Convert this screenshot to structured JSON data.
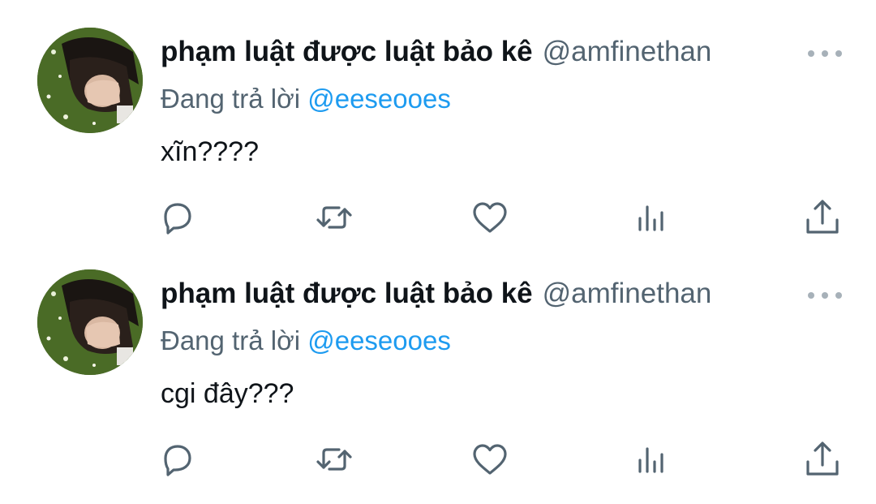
{
  "tweets": [
    {
      "author": {
        "name": "phạm luật được luật bảo kê",
        "handle": "@amfinethan"
      },
      "replying_prefix": "Đang trả lời",
      "replying_to": "@eeseooes",
      "text": "xĩn????"
    },
    {
      "author": {
        "name": "phạm luật được luật bảo kê",
        "handle": "@amfinethan"
      },
      "replying_prefix": "Đang trả lời",
      "replying_to": "@eeseooes",
      "text": "cgi đây???"
    }
  ],
  "icons": [
    "more-icon",
    "reply-icon",
    "retweet-icon",
    "like-icon",
    "views-icon",
    "share-icon"
  ],
  "colors": {
    "text": "#0f1419",
    "secondary": "#536471",
    "accent": "#1d9bf0",
    "icon": "#536471"
  }
}
